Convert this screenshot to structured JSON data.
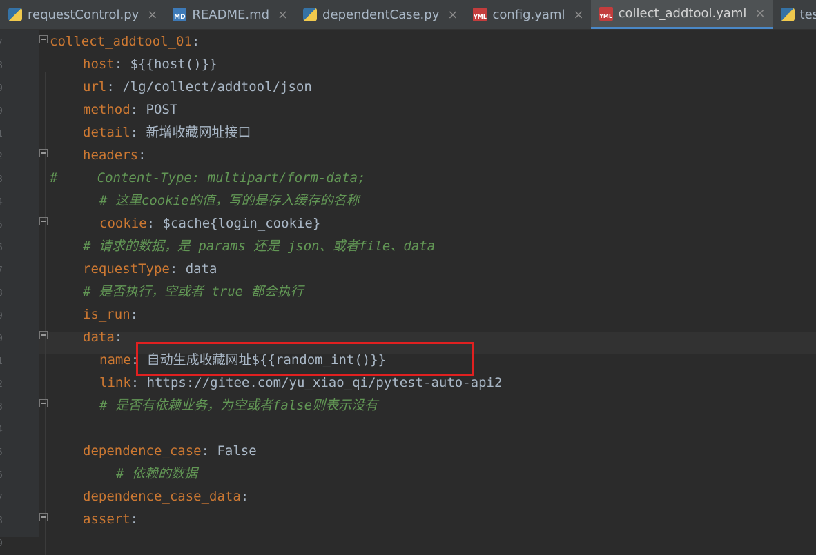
{
  "tabs": [
    {
      "label": "requestControl.py",
      "icon": "python-file-icon"
    },
    {
      "label": "README.md",
      "icon": "markdown-file-icon"
    },
    {
      "label": "dependentCase.py",
      "icon": "python-file-icon"
    },
    {
      "label": "config.yaml",
      "icon": "yaml-file-icon"
    },
    {
      "label": "collect_addtool.yaml",
      "icon": "yaml-file-icon",
      "active": true
    },
    {
      "label": "test_co",
      "icon": "python-file-icon"
    }
  ],
  "icon_text": {
    "md": "MD",
    "yml": "YML"
  },
  "close_glyph": "×",
  "line_numbers": [
    "7",
    "8",
    "9",
    "0",
    "1",
    "2",
    "3",
    "4",
    "5",
    "6",
    "7",
    "8",
    "9",
    "0",
    "1",
    "2",
    "3",
    "4",
    "5",
    "6",
    "7",
    "8",
    "9"
  ],
  "code": {
    "l1_key": "collect_addtool_01",
    "colon": ":",
    "l2_key": "host",
    "l2_val": " ${{host()}}",
    "l3_key": "url",
    "l3_val": " /lg/collect/addtool/json",
    "l4_key": "method",
    "l4_val": " POST",
    "l5_key": "detail",
    "l5_val": " 新增收藏网址接口",
    "l6_key": "headers",
    "l7_comment": "#     Content-Type: multipart/form-data;",
    "l8_comment": "# 这里cookie的值，写的是存入缓存的名称",
    "l9_key": "cookie",
    "l9_val": " $cache{login_cookie}",
    "l10_comment": "# 请求的数据，是 params 还是 json、或者file、data",
    "l11_key": "requestType",
    "l11_val": " data",
    "l12_comment": "# 是否执行，空或者 true 都会执行",
    "l13_key": "is_run",
    "l14_key": "data",
    "l15_key": "name",
    "l15_val": " 自动生成收藏网址${{random_int()}}",
    "l16_key": "link",
    "l16_val": " https://gitee.com/yu_xiao_qi/pytest-auto-api2",
    "l17_comment": "# 是否有依赖业务，为空或者false则表示没有",
    "l19_key": "dependence_case",
    "l19_val": " False",
    "l20_comment": "# 依赖的数据",
    "l21_key": "dependence_case_data",
    "l22_key": "assert"
  },
  "colors": {
    "key": "#cc7832",
    "value": "#a9b7c6",
    "comment": "#629755",
    "highlight_box": "#e02020"
  }
}
